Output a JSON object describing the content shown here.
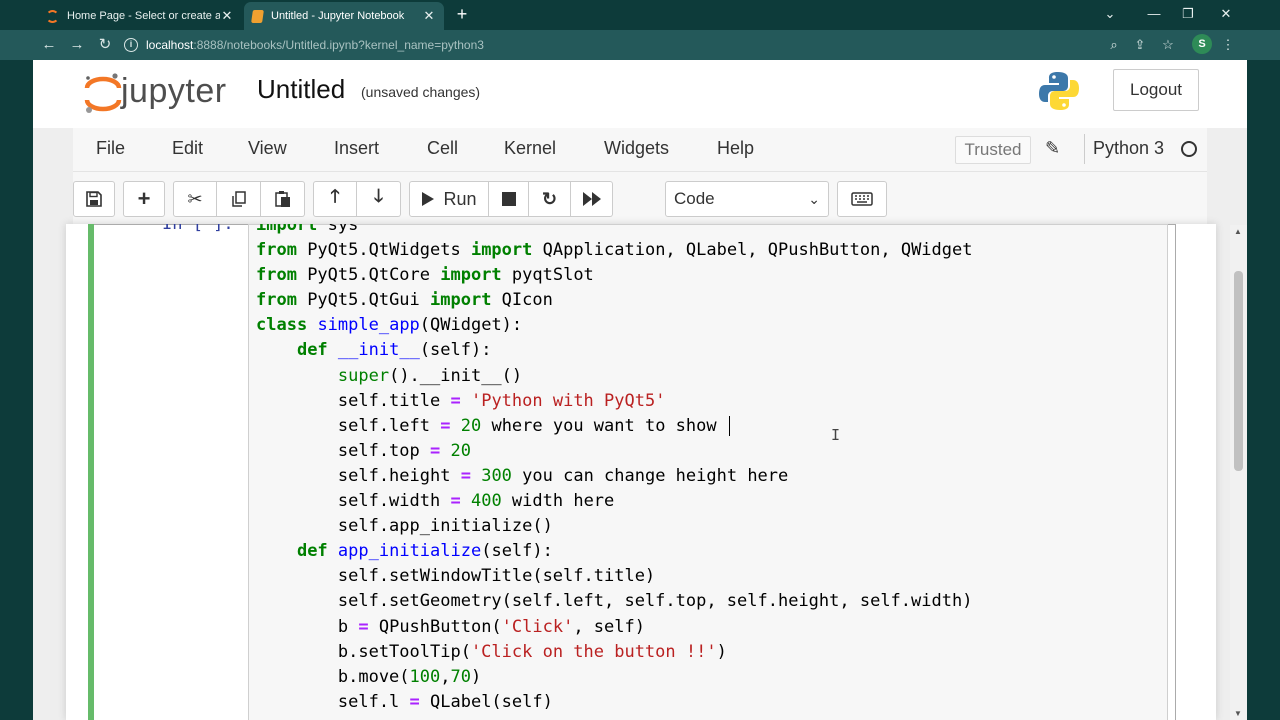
{
  "browser": {
    "tabs": [
      {
        "label": "Home Page - Select or create a n",
        "active": false
      },
      {
        "label": "Untitled - Jupyter Notebook",
        "active": true
      }
    ],
    "url_host": "localhost",
    "url_path": ":8888/notebooks/Untitled.ipynb?kernel_name=python3",
    "profile_initial": "S"
  },
  "header": {
    "logo_text": "jupyter",
    "notebook_name": "Untitled",
    "autosave_status": "(unsaved changes)",
    "logout_label": "Logout"
  },
  "menubar": {
    "items": [
      "File",
      "Edit",
      "View",
      "Insert",
      "Cell",
      "Kernel",
      "Widgets",
      "Help"
    ],
    "trusted_label": "Trusted",
    "kernel_name": "Python 3"
  },
  "toolbar": {
    "run_label": "Run",
    "cell_type": "Code"
  },
  "cell": {
    "prompt": "In [ ]:",
    "code_lines": [
      "import sys",
      "from PyQt5.QtWidgets import QApplication, QLabel, QPushButton, QWidget",
      "from PyQt5.QtCore import pyqtSlot",
      "from PyQt5.QtGui import QIcon",
      "class simple_app(QWidget):",
      "    def __init__(self):",
      "        super().__init__()",
      "        self.title = 'Python with PyQt5'",
      "        self.left = 20 where you want to show ",
      "        self.top = 20",
      "        self.height = 300 you can change height here",
      "        self.width = 400 width here",
      "        self.app_initialize()",
      "    def app_initialize(self):",
      "        self.setWindowTitle(self.title)",
      "        self.setGeometry(self.left, self.top, self.height, self.width)",
      "        b = QPushButton('Click', self)",
      "        b.setToolTip('Click on the button !!')",
      "        b.move(100,70)",
      "        self.l = QLabel(self)"
    ]
  },
  "colors": {
    "browser_frame": "#0d3b3a",
    "address_bar": "#24595a",
    "cell_edit_bar": "#66bb6a",
    "keyword": "#008000",
    "string": "#ba2121",
    "def_name": "#0000ff"
  }
}
